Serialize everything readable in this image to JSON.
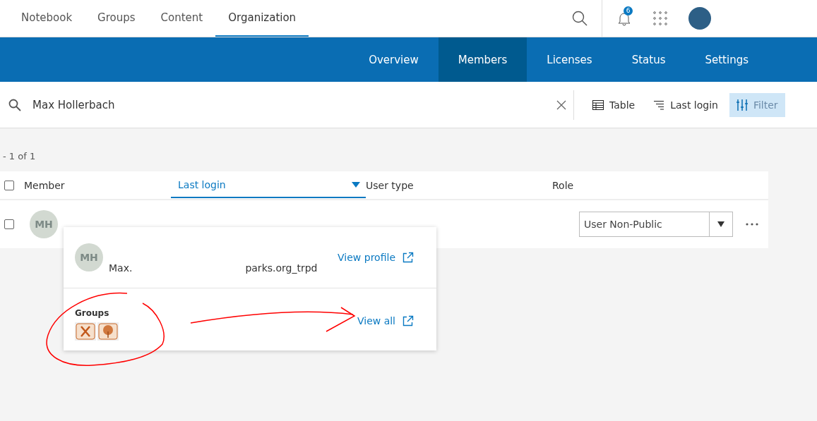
{
  "top_nav": {
    "items": [
      {
        "label": "Notebook",
        "selected": false
      },
      {
        "label": "Groups",
        "selected": false
      },
      {
        "label": "Content",
        "selected": false
      },
      {
        "label": "Organization",
        "selected": true
      }
    ],
    "notification_count": "6"
  },
  "sub_nav": {
    "items": [
      {
        "label": "Overview",
        "selected": false
      },
      {
        "label": "Members",
        "selected": true
      },
      {
        "label": "Licenses",
        "selected": false
      },
      {
        "label": "Status",
        "selected": false
      },
      {
        "label": "Settings",
        "selected": false
      }
    ]
  },
  "search": {
    "value": "Max Hollerbach"
  },
  "toolbar": [
    {
      "kind": "table",
      "label": "Table",
      "selected": false
    },
    {
      "kind": "sort",
      "label": "Last login",
      "selected": false
    },
    {
      "kind": "filter",
      "label": "Filter",
      "selected": true
    }
  ],
  "result_count": "- 1 of 1",
  "table": {
    "select_all_checked": false,
    "columns": [
      {
        "label": "Member",
        "sorted": false
      },
      {
        "label": "Last login",
        "sorted": true
      },
      {
        "label": "User type",
        "sorted": false
      },
      {
        "label": "Role",
        "sorted": false
      }
    ],
    "rows": [
      {
        "checked": false,
        "initials": "MH",
        "role": "User Non-Public"
      }
    ]
  },
  "popup": {
    "initials": "MH",
    "email_start": "Max.",
    "email_end": "parks.org_trpd",
    "profile_link": "View profile",
    "groups_title": "Groups",
    "view_all": "View all"
  }
}
